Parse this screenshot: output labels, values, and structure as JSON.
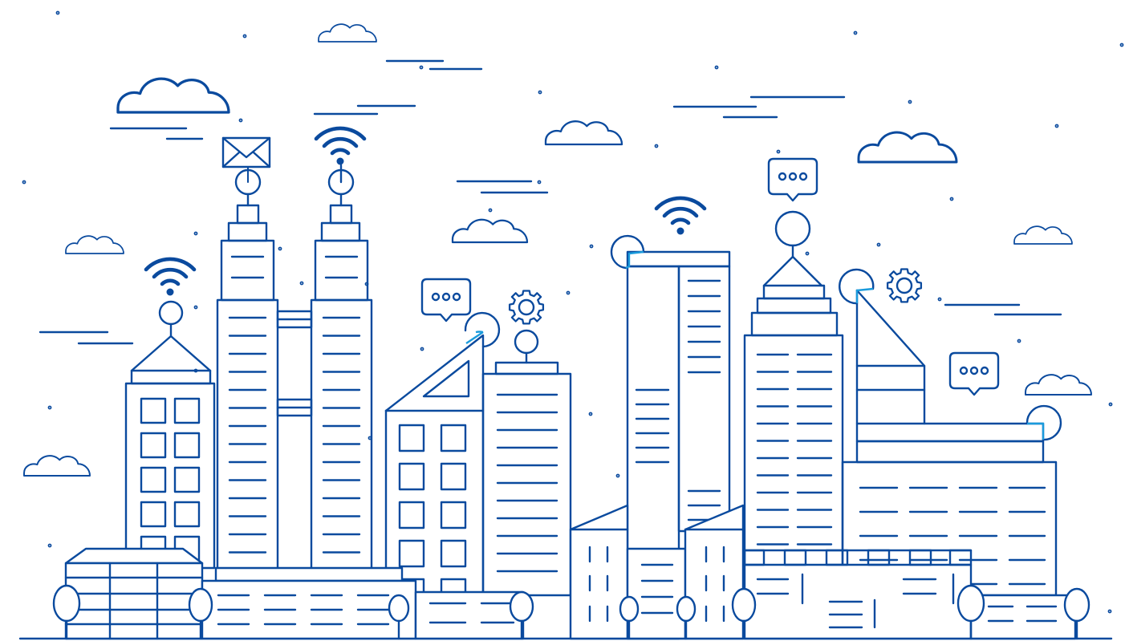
{
  "colors": {
    "line": "#0a4a9e",
    "accent": "#1a9bdc",
    "background": "#ffffff"
  },
  "icons": [
    "envelope-icon",
    "wifi-icon",
    "chat-bubble-icon",
    "gear-icon",
    "cloud-icon"
  ]
}
